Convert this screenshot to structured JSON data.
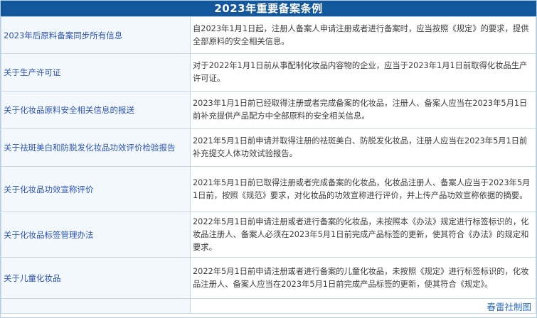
{
  "title": "2023年重要备案条例",
  "rows": [
    {
      "topic": "2023年后原料备案同步所有信息",
      "detail": "自2023年1月1日起，注册人备案人申请注册或者进行备案时，应当按照《规定》的要求，提供全部原料的安全相关信息。"
    },
    {
      "topic": "关于生产许可证",
      "detail": "对于2022年1月1日前从事配制化妆品内容物的企业，应当于2023年1月1日前取得化妆品生产许可证。"
    },
    {
      "topic": "关于化妆品原料安全相关信息的报送",
      "detail": "2023年1月1日前已经取得注册或者完成备案的化妆品，注册人、备案人应当在2023年5月1日前补充提供产品配方中全部原料的安全相关信息。"
    },
    {
      "topic": "关于祛斑美白和防脱发化妆品功效评价检验报告",
      "detail": "2021年5月1日前申请并取得注册的祛斑美白、防脱发化妆品，注册人应当在2023年5月1日前补充提交人体功效试验报告。"
    },
    {
      "topic": "关于化妆品功效宣称评价",
      "detail": "2021年5月1日前已取得注册或者完成备案的化妆品，化妆品注册人、备案人应当于2023年5月1日前，按照《规范》要求，对化妆品的功效宣称进行评价，并上传产品功效宣称依据的摘要。"
    },
    {
      "topic": "关于化妆品标签管理办法",
      "detail": "2022年5月1日前申请注册或者进行备案的化妆品，未按照本《办法》规定进行标签标识的，化妆品注册人、备案人必须在2023年5月1日前完成产品标签的更新，使其符合《办法》的规定和要求。"
    },
    {
      "topic": "关于儿童化妆品",
      "detail": "2022年5月1日前申请注册或者进行备案的儿童化妆品，未按照《规定》进行标签标识的，化妆品注册人、备案人应当在2023年5月1日前完成产品标签的更新，使其符合《规定》。"
    }
  ],
  "footer": "春雷社制图"
}
